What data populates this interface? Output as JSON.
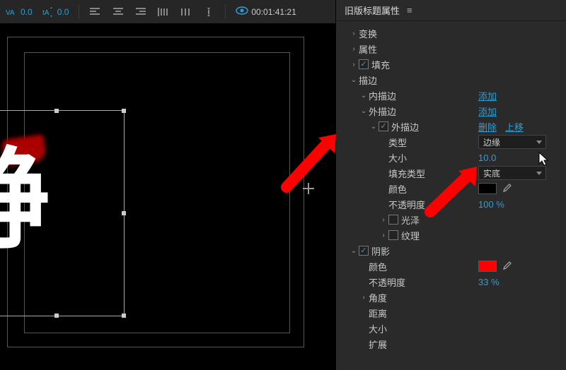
{
  "toolbar": {
    "tracking_value": "0.0",
    "baseline_value": "0.0",
    "timecode": "00:01:41:21"
  },
  "panel": {
    "title": "旧版标题属性",
    "sections": {
      "transform": "变换",
      "attributes": "属性",
      "fill": "填充",
      "stroke": "描边",
      "inner_stroke": "内描边",
      "outer_stroke": "外描边",
      "outer_stroke_item": "外描边",
      "add": "添加",
      "delete": "删除",
      "move_up": "上移",
      "type": "类型",
      "type_value": "边缘",
      "size": "大小",
      "size_value": "10.0",
      "fill_type": "填充类型",
      "fill_type_value": "实底",
      "color": "颜色",
      "opacity": "不透明度",
      "opacity_value": "100 %",
      "gloss": "光泽",
      "texture": "纹理",
      "shadow": "阴影",
      "shadow_color": "颜色",
      "shadow_opacity": "不透明度",
      "shadow_opacity_value": "33 %",
      "angle": "角度",
      "distance": "距离",
      "shadow_size": "大小",
      "spread": "扩展"
    },
    "colors": {
      "stroke_color": "#000000",
      "shadow_color": "#ff0000"
    }
  },
  "canvas": {
    "text": "静"
  }
}
